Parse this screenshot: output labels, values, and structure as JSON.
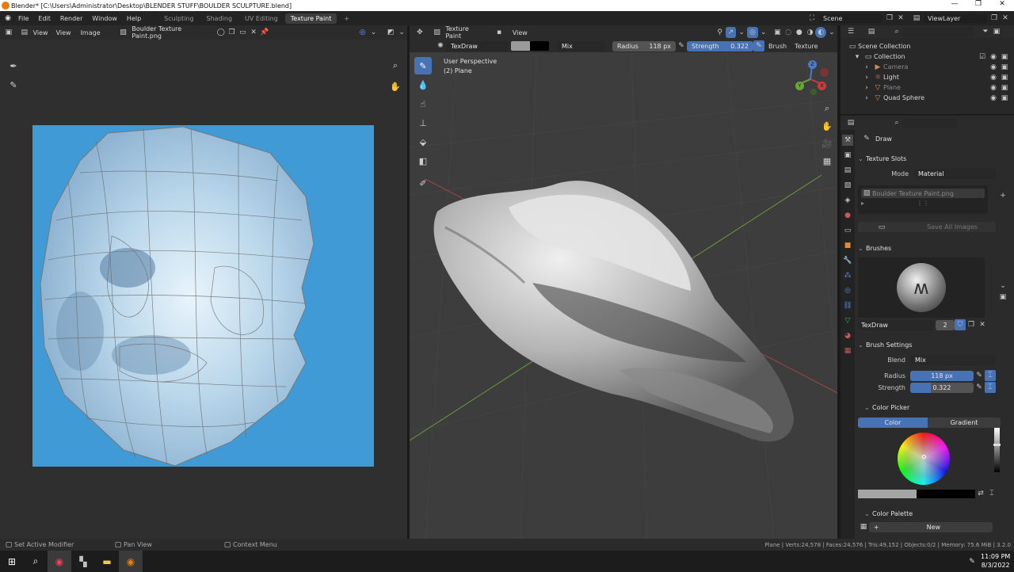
{
  "window": {
    "title": "Blender* [C:\\Users\\Administrator\\Desktop\\BLENDER STUFF\\BOULDER SCULPTURE.blend]",
    "controls": [
      "—",
      "❐",
      "✕"
    ]
  },
  "menu": {
    "items": [
      "File",
      "Edit",
      "Render",
      "Window",
      "Help"
    ],
    "workspaces": [
      "Sculpting",
      "Shading",
      "UV Editing",
      "Texture Paint"
    ],
    "active_workspace": "Texture Paint",
    "add_tab": "+",
    "scene": "Scene",
    "view_layer": "ViewLayer"
  },
  "image_editor": {
    "header": {
      "view": "View",
      "view2": "View",
      "image": "Image",
      "image_name": "Boulder Texture Paint.png"
    }
  },
  "viewport": {
    "header": {
      "mode": "Texture Paint",
      "view": "View"
    },
    "tool_header": {
      "brush": "TexDraw",
      "blend": "Mix",
      "radius_label": "Radius",
      "radius_value": "118 px",
      "strength_label": "Strength",
      "strength_value": "0.322",
      "brush_menu": "Brush",
      "texture_menu": "Texture"
    },
    "overlay_text": {
      "perspective": "User Perspective",
      "object": "(2) Plane"
    },
    "gizmo": {
      "z": "Z",
      "y": "Y",
      "x": "X"
    }
  },
  "outliner": {
    "items": [
      {
        "label": "Scene Collection",
        "dim": false
      },
      {
        "label": "Collection",
        "dim": false
      },
      {
        "label": "Camera",
        "dim": true
      },
      {
        "label": "Light",
        "dim": false
      },
      {
        "label": "Plane",
        "dim": true
      },
      {
        "label": "Quad Sphere",
        "dim": false
      }
    ]
  },
  "properties": {
    "tool_name": "Draw",
    "texture_slots": {
      "header": "Texture Slots",
      "mode_label": "Mode",
      "mode_value": "Material",
      "slot": "Boulder Texture Paint.png",
      "save_all": "Save All Images"
    },
    "brushes": {
      "header": "Brushes",
      "brush_name": "TexDraw",
      "users": "2"
    },
    "brush_settings": {
      "header": "Brush Settings",
      "blend_label": "Blend",
      "blend_value": "Mix",
      "radius_label": "Radius",
      "radius_value": "118 px",
      "strength_label": "Strength",
      "strength_value": "0.322",
      "strength_fraction": 0.322
    },
    "color_picker": {
      "header": "Color Picker",
      "tab_color": "Color",
      "tab_gradient": "Gradient"
    },
    "color_palette": {
      "header": "Color Palette",
      "new_button": "New"
    }
  },
  "statusbar": {
    "left1": "Set Active Modifier",
    "left2": "Pan View",
    "left3": "Context Menu",
    "stats": "Plane | Verts:24,578 | Faces:24,576 | Tris:49,152 | Objects:0/2 | Memory: 75.6 MiB | 3.2.0"
  },
  "taskbar": {
    "time": "11:09 PM",
    "date": "8/3/2022"
  },
  "colors": {
    "accent": "#4772b3",
    "uv_background": "#3f9ad6",
    "viewport_bg": "#3d3d3d"
  }
}
